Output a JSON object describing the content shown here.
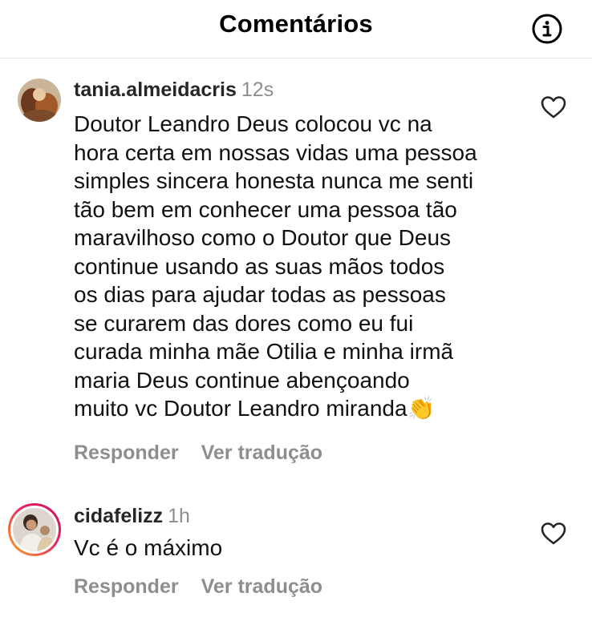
{
  "header": {
    "title": "Comentários",
    "info_icon": "info-icon"
  },
  "comments": [
    {
      "username": "tania.almeidacris",
      "time": "12s",
      "text": "Doutor Leandro  Deus colocou  vc na\nhora certa em nossas vidas uma pessoa\nsimples sincera honesta nunca me senti\ntão  bem em conhecer uma pessoa tão\nmaravilhoso como o Doutor que Deus\ncontinue usando as suas mãos  todos\nos dias para ajudar  todas as pessoas\nse curarem das dores como eu fui\ncurada  minha mãe Otilia  e minha irmã\nmaria Deus continue  abençoando\nmuito vc Doutor Leandro miranda",
      "emoji": "👏",
      "reply_label": "Responder",
      "translate_label": "Ver tradução"
    },
    {
      "username": "cidafelizz",
      "time": "1h",
      "text": "Vc é o máximo",
      "reply_label": "Responder",
      "translate_label": "Ver tradução"
    }
  ],
  "colors": {
    "secondary_text": "#8e8e8e",
    "story_ring_start": "#f9a825",
    "story_ring_end": "#c2185b"
  }
}
